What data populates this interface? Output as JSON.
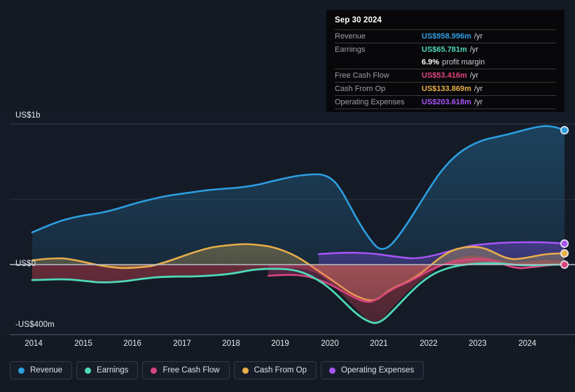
{
  "tooltip": {
    "date": "Sep 30 2024",
    "rows": [
      {
        "label": "Revenue",
        "value": "US$958.996m",
        "unit": "/yr",
        "color": "#2d9ee0"
      },
      {
        "label": "Earnings",
        "value": "US$65.781m",
        "unit": "/yr",
        "color": "#4fd8b8"
      },
      {
        "label": "",
        "value": "6.9%",
        "unit": "profit margin",
        "color": "#ffffff"
      },
      {
        "label": "Free Cash Flow",
        "value": "US$53.416m",
        "unit": "/yr",
        "color": "#e0447b"
      },
      {
        "label": "Cash From Op",
        "value": "US$133.869m",
        "unit": "/yr",
        "color": "#e8ae4a"
      },
      {
        "label": "Operating Expenses",
        "value": "US$203.618m",
        "unit": "/yr",
        "color": "#a855f7"
      }
    ]
  },
  "legend": {
    "items": [
      {
        "label": "Revenue",
        "color": "#2d9ee0"
      },
      {
        "label": "Earnings",
        "color": "#4fd8b8"
      },
      {
        "label": "Free Cash Flow",
        "color": "#d8457e"
      },
      {
        "label": "Cash From Op",
        "color": "#e8ae4a"
      },
      {
        "label": "Operating Expenses",
        "color": "#a855f7"
      }
    ]
  },
  "axes": {
    "y_labels": [
      "US$1b",
      "US$0",
      "-US$400m"
    ],
    "x_labels": [
      "2014",
      "2015",
      "2016",
      "2017",
      "2018",
      "2019",
      "2020",
      "2021",
      "2022",
      "2023",
      "2024"
    ]
  },
  "chart_data": {
    "type": "area",
    "title": "",
    "xlabel": "",
    "ylabel": "",
    "ylim": [
      -400,
      1000
    ],
    "y_unit": "US$m",
    "grid": true,
    "legend_position": "bottom",
    "y_ticks": [
      {
        "label": "US$1b",
        "value": 1000
      },
      {
        "label": "",
        "value": 500
      },
      {
        "label": "US$0",
        "value": 0
      },
      {
        "label": "-US$400m",
        "value": -400
      }
    ],
    "x": [
      "2014",
      "2015",
      "2016",
      "2017",
      "2018",
      "2019",
      "2020",
      "2021",
      "2022",
      "2023",
      "2024",
      "2024.75"
    ],
    "series": [
      {
        "name": "Revenue",
        "color": "#2d9ee0",
        "values": [
          222,
          320,
          385,
          470,
          520,
          600,
          490,
          60,
          430,
          790,
          930,
          959
        ]
      },
      {
        "name": "Earnings",
        "color": "#4fd8b8",
        "values": [
          -96,
          -116,
          -112,
          -82,
          -44,
          -22,
          -120,
          -380,
          -105,
          36,
          50,
          66
        ]
      },
      {
        "name": "Free Cash Flow",
        "color": "#d8457e",
        "values": [
          null,
          null,
          null,
          null,
          null,
          -40,
          -120,
          -260,
          -95,
          80,
          40,
          53
        ]
      },
      {
        "name": "Cash From Op",
        "color": "#e8ae4a",
        "values": [
          20,
          30,
          6,
          12,
          62,
          76,
          -36,
          -208,
          -58,
          150,
          100,
          134
        ]
      },
      {
        "name": "Operating Expenses",
        "color": "#a855f7",
        "values": [
          null,
          null,
          null,
          null,
          null,
          null,
          62,
          70,
          125,
          180,
          190,
          204
        ]
      }
    ],
    "end_markers": [
      {
        "name": "Revenue",
        "value": 959
      },
      {
        "name": "Operating Expenses",
        "value": 204
      },
      {
        "name": "Cash From Op",
        "value": 134
      },
      {
        "name": "Free Cash Flow",
        "value": 53
      }
    ]
  }
}
